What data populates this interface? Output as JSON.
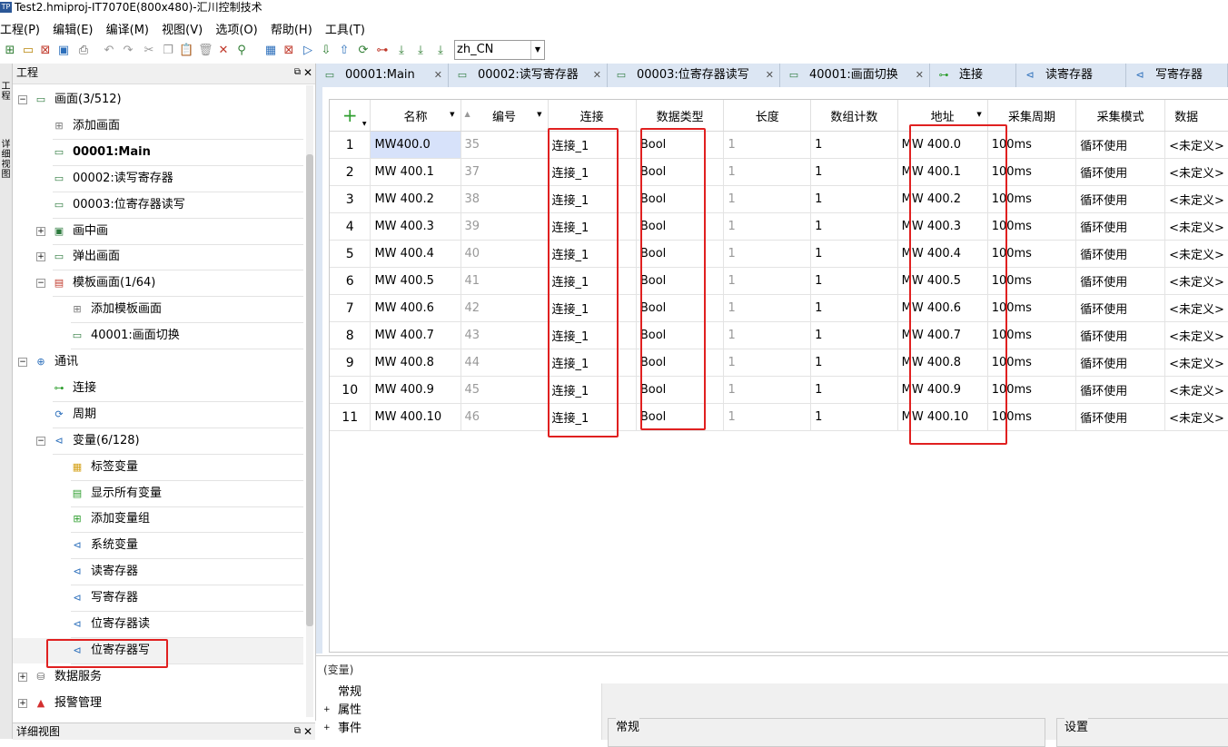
{
  "window": {
    "title": "Test2.hmiproj-IT7070E(800x480)-汇川控制技术",
    "icon_text": "TP"
  },
  "menu": [
    "工程(P)",
    "编辑(E)",
    "编译(M)",
    "视图(V)",
    "选项(O)",
    "帮助(H)",
    "工具(T)"
  ],
  "toolbar": {
    "language": "zh_CN"
  },
  "left_strip": {
    "project_tab": "工程",
    "detail_tab": "详细视图"
  },
  "project_panel": {
    "title": "工程",
    "tree": [
      {
        "label": "画面(3/512)",
        "level": 0,
        "expander": "−",
        "icon": "screen-icon",
        "bold": false
      },
      {
        "label": "添加画面",
        "level": 1,
        "expander": "",
        "icon": "add-icon",
        "bold": false
      },
      {
        "label": "00001:Main",
        "level": 1,
        "expander": "",
        "icon": "screen-icon",
        "bold": true
      },
      {
        "label": "00002:读写寄存器",
        "level": 1,
        "expander": "",
        "icon": "screen-icon",
        "bold": false
      },
      {
        "label": "00003:位寄存器读写",
        "level": 1,
        "expander": "",
        "icon": "screen-icon",
        "bold": false
      },
      {
        "label": "画中画",
        "level": 1,
        "expander": "+",
        "icon": "pip-icon",
        "bold": false
      },
      {
        "label": "弹出画面",
        "level": 1,
        "expander": "+",
        "icon": "popup-icon",
        "bold": false
      },
      {
        "label": "模板画面(1/64)",
        "level": 1,
        "expander": "−",
        "icon": "template-icon",
        "bold": false
      },
      {
        "label": "添加模板画面",
        "level": 2,
        "expander": "",
        "icon": "add-icon",
        "bold": false
      },
      {
        "label": "40001:画面切换",
        "level": 2,
        "expander": "",
        "icon": "screen-icon",
        "bold": false
      },
      {
        "label": "通讯",
        "level": 0,
        "expander": "−",
        "icon": "globe-icon",
        "bold": false
      },
      {
        "label": "连接",
        "level": 1,
        "expander": "",
        "icon": "connection-icon",
        "bold": false
      },
      {
        "label": "周期",
        "level": 1,
        "expander": "",
        "icon": "cycle-icon",
        "bold": false
      },
      {
        "label": "变量(6/128)",
        "level": 1,
        "expander": "−",
        "icon": "variable-icon",
        "bold": false
      },
      {
        "label": "标签变量",
        "level": 2,
        "expander": "",
        "icon": "tag-folder-icon",
        "bold": false
      },
      {
        "label": "显示所有变量",
        "level": 2,
        "expander": "",
        "icon": "show-all-icon",
        "bold": false
      },
      {
        "label": "添加变量组",
        "level": 2,
        "expander": "",
        "icon": "add-group-icon",
        "bold": false
      },
      {
        "label": "系统变量",
        "level": 2,
        "expander": "",
        "icon": "variable-icon",
        "bold": false
      },
      {
        "label": "读寄存器",
        "level": 2,
        "expander": "",
        "icon": "variable-icon",
        "bold": false
      },
      {
        "label": "写寄存器",
        "level": 2,
        "expander": "",
        "icon": "variable-icon",
        "bold": false
      },
      {
        "label": "位寄存器读",
        "level": 2,
        "expander": "",
        "icon": "variable-icon",
        "bold": false
      },
      {
        "label": "位寄存器写",
        "level": 2,
        "expander": "",
        "icon": "variable-icon",
        "bold": false,
        "selected": true
      },
      {
        "label": "数据服务",
        "level": 0,
        "expander": "+",
        "icon": "database-icon",
        "bold": false
      },
      {
        "label": "报警管理",
        "level": 0,
        "expander": "+",
        "icon": "alarm-icon",
        "bold": false
      }
    ]
  },
  "detail_panel": {
    "title": "详细视图"
  },
  "tabs": [
    {
      "label": "00001:Main",
      "icon": "screen-icon"
    },
    {
      "label": "00002:读写寄存器",
      "icon": "screen-icon"
    },
    {
      "label": "00003:位寄存器读写",
      "icon": "screen-icon"
    },
    {
      "label": "40001:画面切换",
      "icon": "screen-icon"
    },
    {
      "label": "连接",
      "icon": "connection-icon"
    },
    {
      "label": "读寄存器",
      "icon": "variable-icon"
    },
    {
      "label": "写寄存器",
      "icon": "variable-icon"
    }
  ],
  "grid": {
    "add_symbol": "+",
    "columns": [
      "名称",
      "编号",
      "连接",
      "数据类型",
      "长度",
      "数组计数",
      "地址",
      "采集周期",
      "采集模式",
      "数据"
    ],
    "rows": [
      {
        "idx": "1",
        "name": "MW400.0",
        "id": "35",
        "conn": "连接_1",
        "type": "Bool",
        "len": "1",
        "count": "1",
        "addr": "MW 400.0",
        "cycle": "100ms",
        "mode": "循环使用",
        "data": "<未定义>"
      },
      {
        "idx": "2",
        "name": "MW 400.1",
        "id": "37",
        "conn": "连接_1",
        "type": "Bool",
        "len": "1",
        "count": "1",
        "addr": "MW 400.1",
        "cycle": "100ms",
        "mode": "循环使用",
        "data": "<未定义>"
      },
      {
        "idx": "3",
        "name": "MW 400.2",
        "id": "38",
        "conn": "连接_1",
        "type": "Bool",
        "len": "1",
        "count": "1",
        "addr": "MW 400.2",
        "cycle": "100ms",
        "mode": "循环使用",
        "data": "<未定义>"
      },
      {
        "idx": "4",
        "name": "MW 400.3",
        "id": "39",
        "conn": "连接_1",
        "type": "Bool",
        "len": "1",
        "count": "1",
        "addr": "MW 400.3",
        "cycle": "100ms",
        "mode": "循环使用",
        "data": "<未定义>"
      },
      {
        "idx": "5",
        "name": "MW 400.4",
        "id": "40",
        "conn": "连接_1",
        "type": "Bool",
        "len": "1",
        "count": "1",
        "addr": "MW 400.4",
        "cycle": "100ms",
        "mode": "循环使用",
        "data": "<未定义>"
      },
      {
        "idx": "6",
        "name": "MW 400.5",
        "id": "41",
        "conn": "连接_1",
        "type": "Bool",
        "len": "1",
        "count": "1",
        "addr": "MW 400.5",
        "cycle": "100ms",
        "mode": "循环使用",
        "data": "<未定义>"
      },
      {
        "idx": "7",
        "name": "MW 400.6",
        "id": "42",
        "conn": "连接_1",
        "type": "Bool",
        "len": "1",
        "count": "1",
        "addr": "MW 400.6",
        "cycle": "100ms",
        "mode": "循环使用",
        "data": "<未定义>"
      },
      {
        "idx": "8",
        "name": "MW 400.7",
        "id": "43",
        "conn": "连接_1",
        "type": "Bool",
        "len": "1",
        "count": "1",
        "addr": "MW 400.7",
        "cycle": "100ms",
        "mode": "循环使用",
        "data": "<未定义>"
      },
      {
        "idx": "9",
        "name": "MW 400.8",
        "id": "44",
        "conn": "连接_1",
        "type": "Bool",
        "len": "1",
        "count": "1",
        "addr": "MW 400.8",
        "cycle": "100ms",
        "mode": "循环使用",
        "data": "<未定义>"
      },
      {
        "idx": "10",
        "name": "MW 400.9",
        "id": "45",
        "conn": "连接_1",
        "type": "Bool",
        "len": "1",
        "count": "1",
        "addr": "MW 400.9",
        "cycle": "100ms",
        "mode": "循环使用",
        "data": "<未定义>"
      },
      {
        "idx": "11",
        "name": "MW 400.10",
        "id": "46",
        "conn": "连接_1",
        "type": "Bool",
        "len": "1",
        "count": "1",
        "addr": "MW 400.10",
        "cycle": "100ms",
        "mode": "循环使用",
        "data": "<未定义>"
      }
    ]
  },
  "properties": {
    "header": "(变量)",
    "items": [
      {
        "label": "常规",
        "expander": ""
      },
      {
        "label": "属性",
        "expander": "+"
      },
      {
        "label": "事件",
        "expander": "+"
      }
    ],
    "groups": [
      "常规",
      "设置"
    ]
  },
  "colors": {
    "highlight_box": "#e02020",
    "selected_cell": "#d7e2fa",
    "tab_bar": "#dce6f3",
    "add_green": "#2e9e2e"
  }
}
